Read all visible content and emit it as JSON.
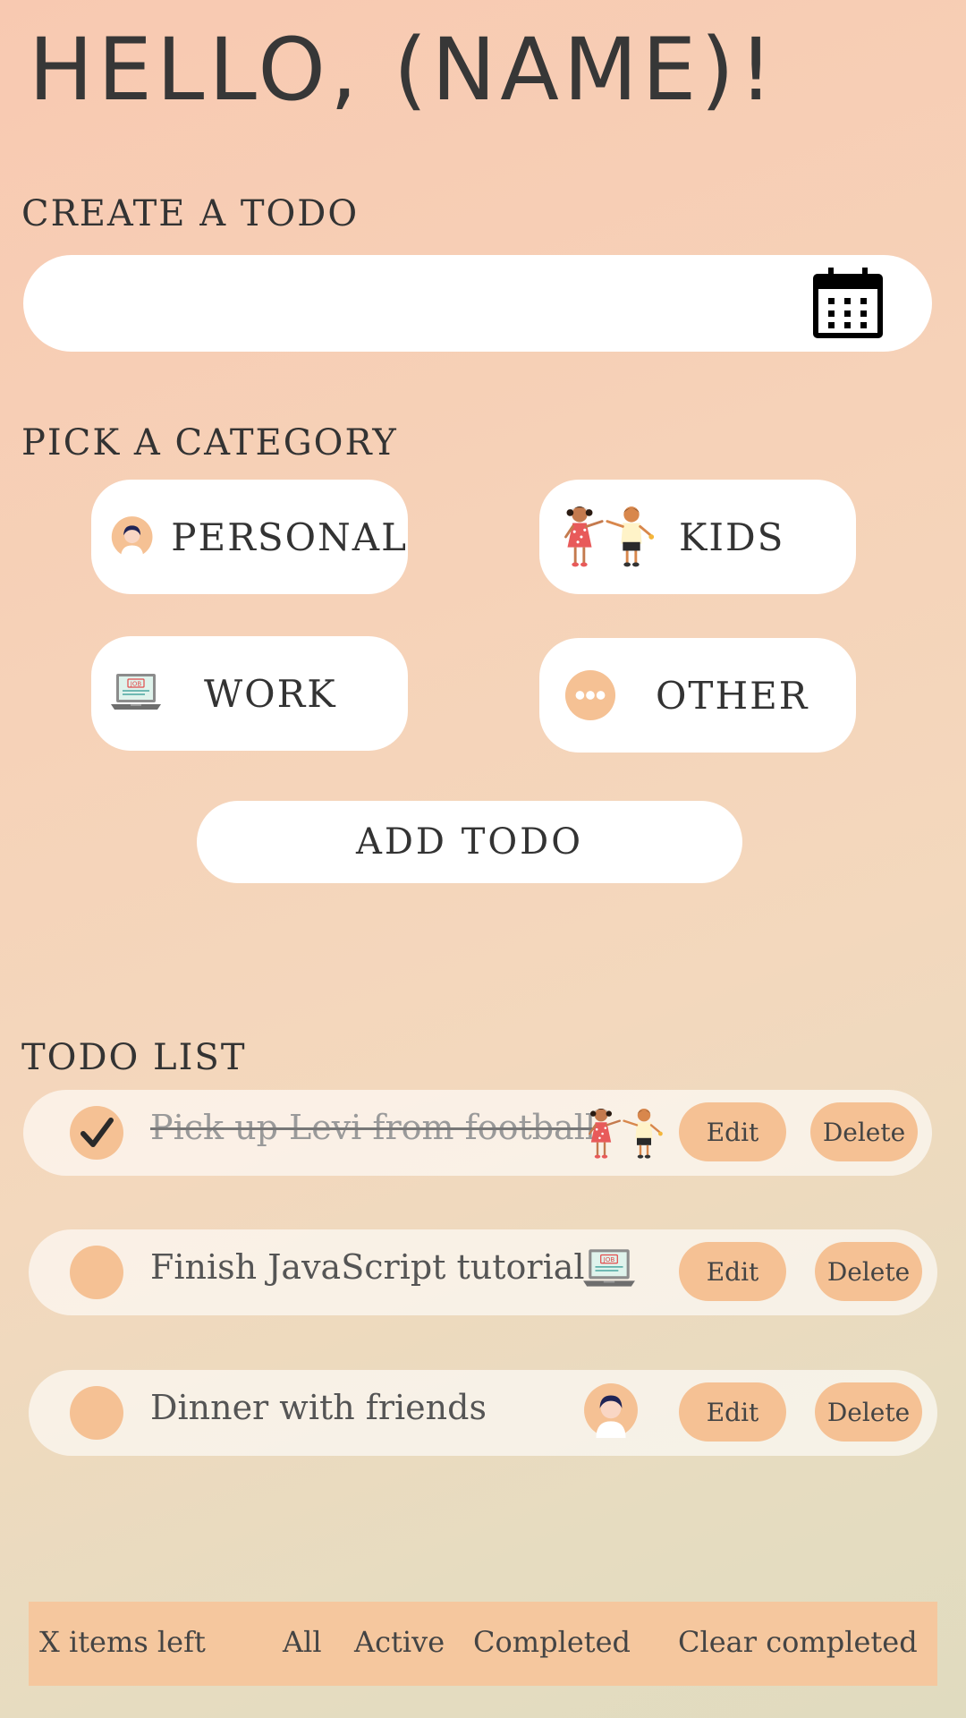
{
  "header": {
    "greeting": "HELLO, (NAME)!"
  },
  "create": {
    "title": "CREATE A TODO",
    "input_value": "",
    "calendar_icon": "calendar-icon"
  },
  "categories": {
    "title": "PICK A CATEGORY",
    "items": [
      {
        "label": "PERSONAL",
        "icon": "person-avatar-icon"
      },
      {
        "label": "KIDS",
        "icon": "kids-icon"
      },
      {
        "label": "WORK",
        "icon": "laptop-job-icon"
      },
      {
        "label": "OTHER",
        "icon": "ellipsis-circle-icon"
      }
    ]
  },
  "add_button": {
    "label": "ADD TODO"
  },
  "list": {
    "title": "TODO LIST",
    "items": [
      {
        "text": "Pick up Levi from football",
        "completed": true,
        "category_icon": "kids-icon",
        "edit_label": "Edit",
        "delete_label": "Delete"
      },
      {
        "text": "Finish JavaScript tutorial",
        "completed": false,
        "category_icon": "laptop-job-icon",
        "edit_label": "Edit",
        "delete_label": "Delete"
      },
      {
        "text": "Dinner with friends",
        "completed": false,
        "category_icon": "person-avatar-icon",
        "edit_label": "Edit",
        "delete_label": "Delete"
      }
    ]
  },
  "footer": {
    "items_left": "X items left",
    "filters": [
      "All",
      "Active",
      "Completed"
    ],
    "clear": "Clear completed"
  },
  "colors": {
    "accent": "#f5c194",
    "footer_bg": "#f5c79e",
    "text": "#333333"
  }
}
